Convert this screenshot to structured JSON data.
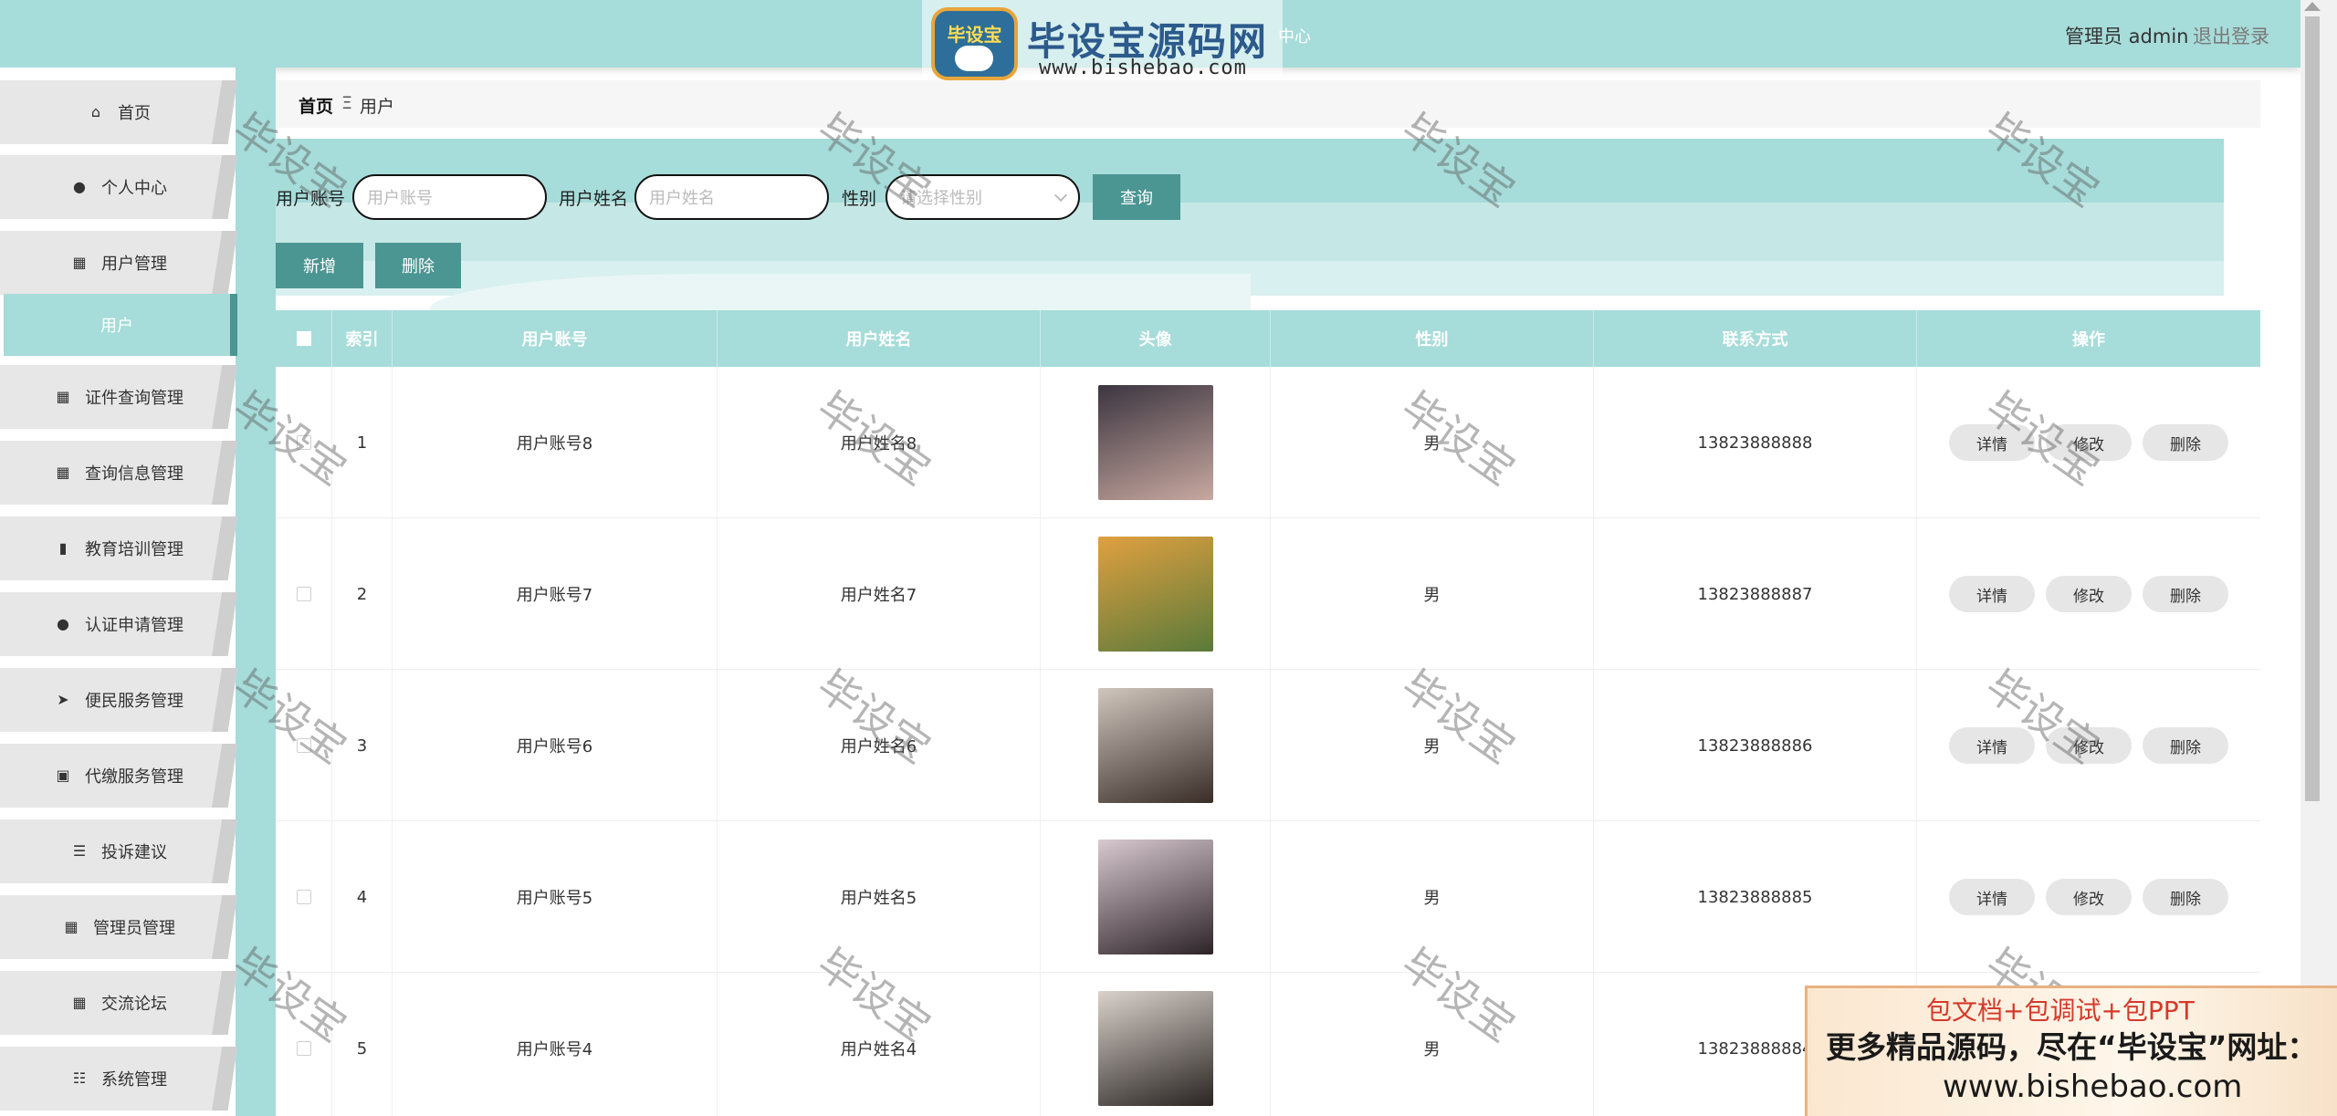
{
  "header": {
    "logo_badge": "毕设宝",
    "logo_title": "毕设宝源码网",
    "logo_url": "www.bishebao.com",
    "hidden_text": "中心",
    "user_role": "管理员 admin",
    "logout_label": "退出登录",
    "bg_color": "#a6dcd9"
  },
  "sidebar": {
    "items": [
      {
        "label": "首页",
        "icon": "home-icon",
        "glyph": "⌂"
      },
      {
        "label": "个人中心",
        "icon": "user-icon",
        "glyph": "●"
      },
      {
        "label": "用户管理",
        "icon": "grid-icon",
        "glyph": "▦"
      },
      {
        "label": "证件查询管理",
        "icon": "grid-icon",
        "glyph": "▦"
      },
      {
        "label": "查询信息管理",
        "icon": "grid-icon",
        "glyph": "▦"
      },
      {
        "label": "教育培训管理",
        "icon": "book-icon",
        "glyph": "▮"
      },
      {
        "label": "认证申请管理",
        "icon": "bulb-icon",
        "glyph": "●"
      },
      {
        "label": "便民服务管理",
        "icon": "send-icon",
        "glyph": "➤"
      },
      {
        "label": "代缴服务管理",
        "icon": "clipboard-icon",
        "glyph": "▣"
      },
      {
        "label": "投诉建议",
        "icon": "list-icon",
        "glyph": "☰"
      },
      {
        "label": "管理员管理",
        "icon": "grid-icon",
        "glyph": "▦"
      },
      {
        "label": "交流论坛",
        "icon": "apps-icon",
        "glyph": "▦"
      },
      {
        "label": "系统管理",
        "icon": "sliders-icon",
        "glyph": "☷"
      }
    ],
    "active_sub": "用户",
    "accent": "#4b9592"
  },
  "breadcrumb": {
    "home": "首页",
    "sep": "Ξ",
    "current": "用户"
  },
  "search": {
    "account_label": "用户账号",
    "account_placeholder": "用户账号",
    "name_label": "用户姓名",
    "name_placeholder": "用户姓名",
    "gender_label": "性别",
    "gender_placeholder": "请选择性别",
    "query_button": "查询",
    "add_button": "新增",
    "delete_button": "删除"
  },
  "table": {
    "columns": [
      "索引",
      "用户账号",
      "用户姓名",
      "头像",
      "性别",
      "联系方式",
      "操作"
    ],
    "rows": [
      {
        "index": "1",
        "account": "用户账号8",
        "name": "用户姓名8",
        "gender": "男",
        "phone": "13823888888",
        "avatar_colors": [
          "#3b3540",
          "#c8a8a0"
        ]
      },
      {
        "index": "2",
        "account": "用户账号7",
        "name": "用户姓名7",
        "gender": "男",
        "phone": "13823888887",
        "avatar_colors": [
          "#e0a040",
          "#5a7a3a"
        ]
      },
      {
        "index": "3",
        "account": "用户账号6",
        "name": "用户姓名6",
        "gender": "男",
        "phone": "13823888886",
        "avatar_colors": [
          "#cfc6be",
          "#3a2d28"
        ]
      },
      {
        "index": "4",
        "account": "用户账号5",
        "name": "用户姓名5",
        "gender": "男",
        "phone": "13823888885",
        "avatar_colors": [
          "#d8c8d0",
          "#2d2428"
        ]
      },
      {
        "index": "5",
        "account": "用户账号4",
        "name": "用户姓名4",
        "gender": "男",
        "phone": "13823888884",
        "avatar_colors": [
          "#d9d2cc",
          "#2a2422"
        ]
      }
    ],
    "actions": {
      "detail": "详情",
      "edit": "修改",
      "delete": "删除"
    }
  },
  "watermark": "毕设宝",
  "ad": {
    "line1": "包文档+包调试+包PPT",
    "line2": "更多精品源码，尽在“毕设宝”网址：",
    "line3": "www.bishebao.com"
  }
}
